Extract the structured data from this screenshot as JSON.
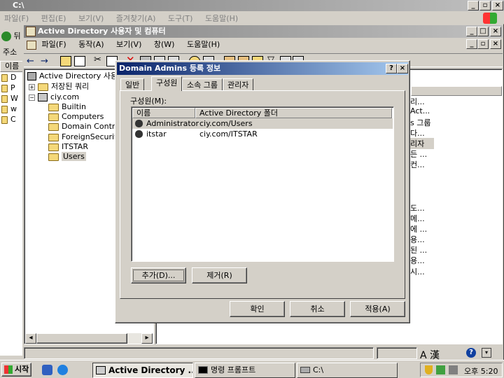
{
  "outer_window": {
    "title": "C:\\",
    "menu": [
      "파일(F)",
      "편집(E)",
      "보기(V)",
      "즐겨찾기(A)",
      "도구(T)",
      "도움말(H)"
    ],
    "address_label": "주소",
    "back_label": "뒤",
    "left_items": [
      "D",
      "P",
      "W",
      "w",
      "C"
    ],
    "name_col": "이름"
  },
  "mmc": {
    "title": "Active Directory 사용자 및 컴퓨터",
    "menu": [
      "파일(F)",
      "동작(A)",
      "보기(V)",
      "창(W)",
      "도움말(H)"
    ]
  },
  "tree": {
    "root": "Active Directory 사용자",
    "saved_queries": "저장된 쿼리",
    "domain": "ciy.com",
    "children": [
      "Builtin",
      "Computers",
      "Domain Contro",
      "ForeignSecurit",
      "ITSTAR",
      "Users"
    ]
  },
  "right_pane": {
    "items": [
      "리...",
      "Act...",
      "s 그룹",
      "다...",
      "리자",
      "든 ...",
      "컨...",
      "도...",
      "메...",
      "에 ...",
      "용...",
      "된 ...",
      "용...",
      "시..."
    ]
  },
  "dialog": {
    "title": "Domain Admins 등록 정보",
    "help_btn": "?",
    "close_btn": "×",
    "tabs": [
      "일반",
      "구성원",
      "소속 그룹",
      "관리자"
    ],
    "members_label": "구성원(M):",
    "columns": [
      "이름",
      "Active Directory 폴더"
    ],
    "rows": [
      {
        "name": "Administrator",
        "folder": "ciy.com/Users"
      },
      {
        "name": "itstar",
        "folder": "ciy.com/ITSTAR"
      }
    ],
    "add_btn": "추가(D)...",
    "remove_btn": "제거(R)",
    "ok_btn": "확인",
    "cancel_btn": "취소",
    "apply_btn": "적용(A)"
  },
  "taskbar": {
    "start": "시작",
    "tasks": [
      "Active Directory ...",
      "명령 프롬프트",
      "C:\\"
    ],
    "clock": "오후 5:20",
    "ime": "A 漢"
  }
}
